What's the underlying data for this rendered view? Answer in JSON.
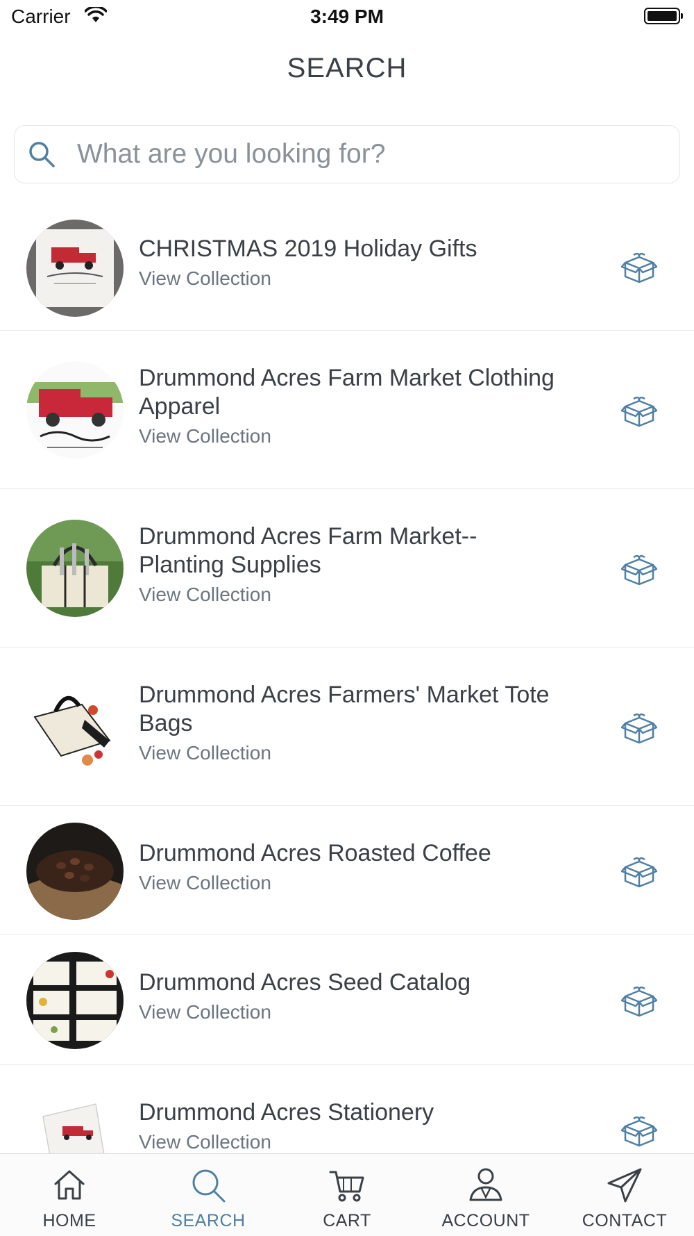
{
  "status_bar": {
    "carrier": "Carrier",
    "time": "3:49 PM"
  },
  "header": {
    "title": "SEARCH"
  },
  "search": {
    "placeholder": "What are you looking for?"
  },
  "collections": [
    {
      "title": "CHRISTMAS 2019 Holiday Gifts",
      "link": "View Collection"
    },
    {
      "title": "Drummond Acres Farm Market Clothing Apparel",
      "link": "View Collection"
    },
    {
      "title": "Drummond Acres Farm Market--Planting Supplies",
      "link": "View Collection"
    },
    {
      "title": "Drummond Acres Farmers' Market Tote Bags",
      "link": "View Collection"
    },
    {
      "title": "Drummond Acres Roasted Coffee",
      "link": "View Collection"
    },
    {
      "title": "Drummond Acres Seed Catalog",
      "link": "View Collection"
    },
    {
      "title": "Drummond Acres Stationery",
      "link": "View Collection"
    }
  ],
  "tabs": [
    {
      "label": "HOME",
      "icon": "home-icon"
    },
    {
      "label": "SEARCH",
      "icon": "search-icon",
      "active": true
    },
    {
      "label": "CART",
      "icon": "cart-icon"
    },
    {
      "label": "ACCOUNT",
      "icon": "account-icon"
    },
    {
      "label": "CONTACT",
      "icon": "paper-plane-icon"
    }
  ],
  "colors": {
    "accent": "#4f7fa3",
    "text": "#3a4047",
    "muted": "#6b7580",
    "divider": "#e8ebed"
  }
}
